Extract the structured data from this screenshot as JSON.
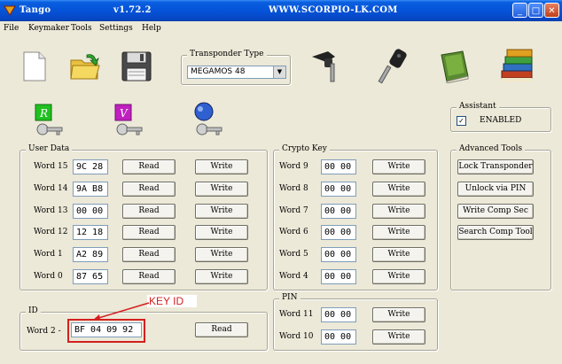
{
  "window": {
    "title": "Tango",
    "version": "v1.72.2",
    "website": "WWW.SCORPIO-LK.COM"
  },
  "menu": [
    "File",
    "Keymaker",
    "Tools",
    "Settings",
    "Help"
  ],
  "transponder": {
    "group_label": "Transponder Type",
    "selected": "MEGAMOS 48"
  },
  "assistant": {
    "group_label": "Assistant",
    "checkbox_label": "ENABLED",
    "checked": true
  },
  "user_data": {
    "group_label": "User Data",
    "read_label": "Read",
    "write_label": "Write",
    "rows": [
      {
        "label": "Word 15",
        "value": "9C 28"
      },
      {
        "label": "Word 14",
        "value": "9A B8"
      },
      {
        "label": "Word 13",
        "value": "00 00"
      },
      {
        "label": "Word 12",
        "value": "12 18"
      },
      {
        "label": "Word  1",
        "value": "A2 89"
      },
      {
        "label": "Word  0",
        "value": "87 65"
      }
    ]
  },
  "crypto_key": {
    "group_label": "Crypto Key",
    "write_label": "Write",
    "rows": [
      {
        "label": "Word  9",
        "value": "00 00"
      },
      {
        "label": "Word  8",
        "value": "00 00"
      },
      {
        "label": "Word  7",
        "value": "00 00"
      },
      {
        "label": "Word  6",
        "value": "00 00"
      },
      {
        "label": "Word  5",
        "value": "00 00"
      },
      {
        "label": "Word  4",
        "value": "00 00"
      }
    ]
  },
  "pin": {
    "group_label": "PIN",
    "write_label": "Write",
    "rows": [
      {
        "label": "Word 11",
        "value": "00 00"
      },
      {
        "label": "Word 10",
        "value": "00 00"
      }
    ]
  },
  "id": {
    "group_label": "ID",
    "label": "Word  2 -",
    "value": "BF 04 09 92",
    "read_label": "Read",
    "annotation": "KEY ID",
    "annotation_color": "#d42020"
  },
  "advanced_tools": {
    "group_label": "Advanced Tools",
    "buttons": [
      "Lock Transponder",
      "Unlock via PIN",
      "Write Comp Sec",
      "Search Comp Tool"
    ]
  },
  "toolbar_icons": [
    "new-file-icon",
    "open-folder-icon",
    "save-disk-icon",
    "car-key-icon",
    "remote-key-icon",
    "book-icon",
    "books-icon"
  ],
  "key_type_icons": [
    {
      "name": "key-r-icon",
      "letter": "R",
      "color": "#21c021"
    },
    {
      "name": "key-v-icon",
      "letter": "V",
      "color": "#c020c0"
    },
    {
      "name": "key-bubble-icon",
      "letter": "",
      "color": "#3060d0"
    }
  ]
}
